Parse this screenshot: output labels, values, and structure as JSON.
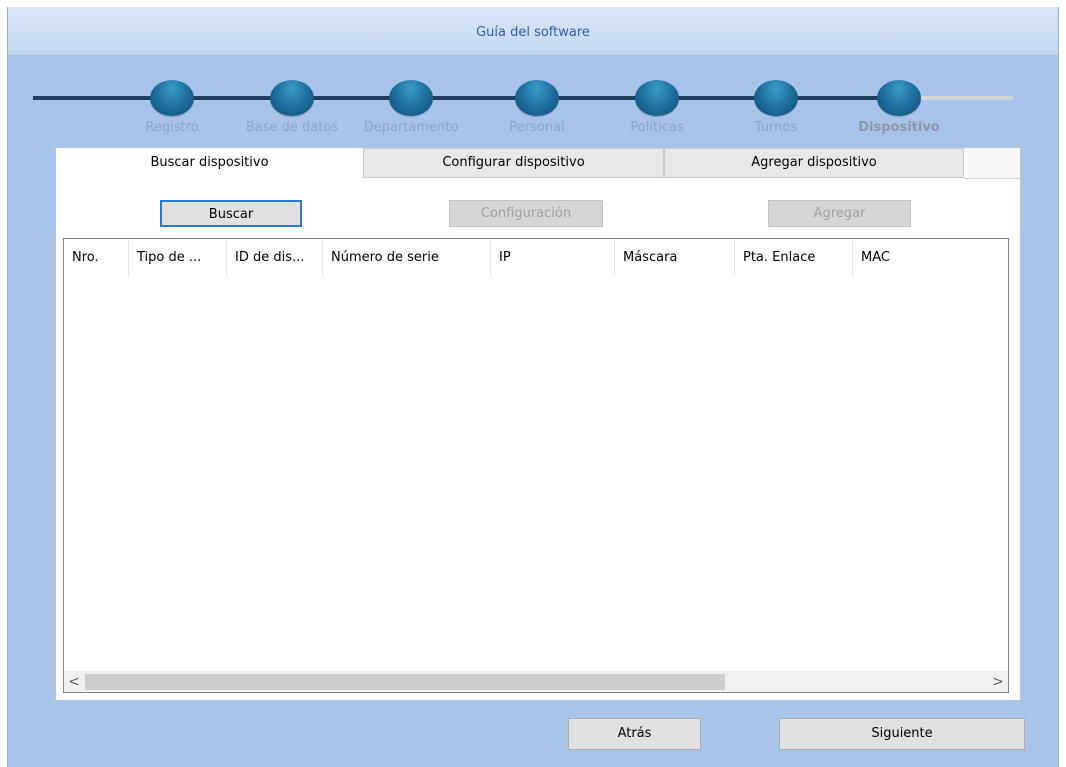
{
  "window": {
    "title": "Guía del software"
  },
  "wizard": {
    "steps": [
      {
        "label": "Registro"
      },
      {
        "label": "Base de datos"
      },
      {
        "label": "Departamento"
      },
      {
        "label": "Personal"
      },
      {
        "label": "Políticas"
      },
      {
        "label": "Turnos"
      },
      {
        "label": "Dispositivo"
      }
    ],
    "current_step": "Dispositivo"
  },
  "tabs": [
    {
      "label": "Buscar dispositivo",
      "active": true
    },
    {
      "label": "Configurar dispositivo",
      "active": false
    },
    {
      "label": "Agregar dispositivo",
      "active": false
    }
  ],
  "actions": {
    "search_label": "Buscar",
    "config_label": "Configuración",
    "add_label": "Agregar"
  },
  "table": {
    "columns": [
      "Nro.",
      "Tipo de ...",
      "ID de dis...",
      "Número de serie",
      "IP",
      "Máscara",
      "Pta. Enlace",
      "MAC"
    ],
    "rows": []
  },
  "scrollbar": {
    "left_arrow": "<",
    "right_arrow": ">"
  },
  "footer": {
    "back_label": "Atrás",
    "next_label": "Siguiente"
  },
  "colors": {
    "accent": "#2b7ad6",
    "step": "#1e6f9e",
    "background": "#a8c3ea"
  }
}
